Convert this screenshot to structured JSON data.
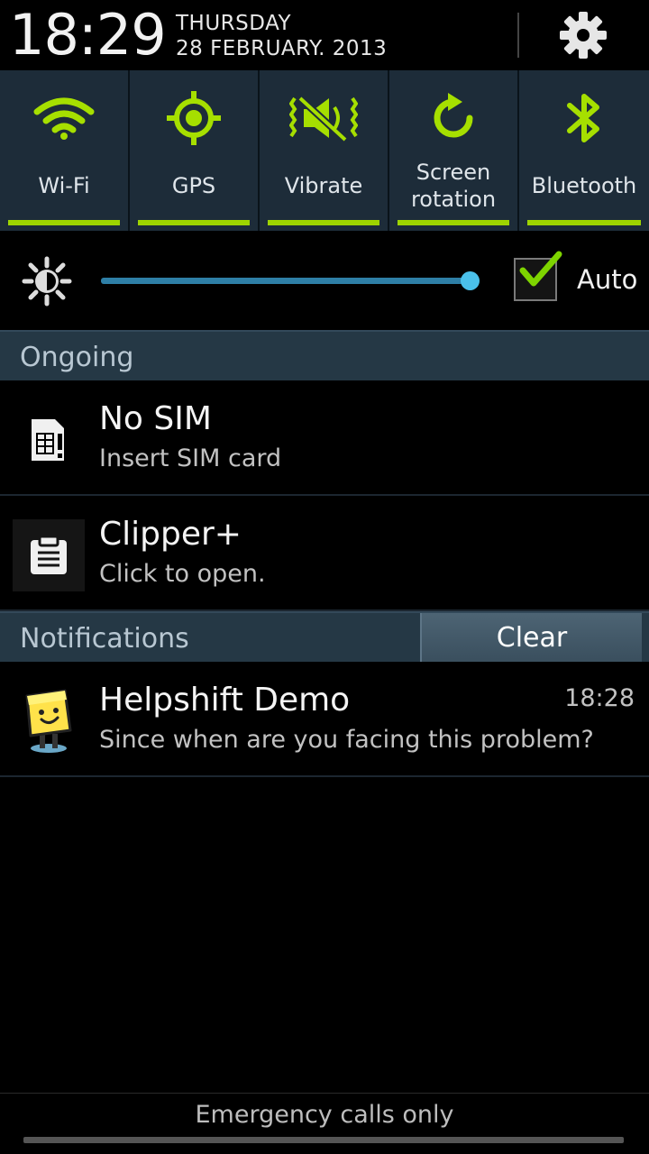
{
  "header": {
    "time": "18:29",
    "day": "THURSDAY",
    "date": "28 FEBRUARY. 2013",
    "settings_icon": "gear-icon"
  },
  "toggles": [
    {
      "label": "Wi-Fi",
      "icon": "wifi-icon",
      "active": true
    },
    {
      "label": "GPS",
      "icon": "gps-icon",
      "active": true
    },
    {
      "label": "Vibrate",
      "icon": "vibrate-icon",
      "active": true
    },
    {
      "label": "Screen rotation",
      "icon": "rotation-icon",
      "active": true
    },
    {
      "label": "Bluetooth",
      "icon": "bluetooth-icon",
      "active": true
    }
  ],
  "brightness": {
    "level": 1.0,
    "auto_label": "Auto",
    "auto_checked": true
  },
  "ongoing": {
    "title": "Ongoing",
    "items": [
      {
        "title": "No SIM",
        "subtitle": "Insert SIM card",
        "icon": "sim-card-icon"
      },
      {
        "title": "Clipper+",
        "subtitle": "Click to open.",
        "icon": "clipboard-icon"
      }
    ]
  },
  "notifications": {
    "title": "Notifications",
    "clear_label": "Clear",
    "items": [
      {
        "title": "Helpshift Demo",
        "subtitle": "Since when are you facing this problem?",
        "time": "18:28",
        "icon": "helpshift-mascot-icon"
      }
    ]
  },
  "footer": {
    "status": "Emergency calls only"
  },
  "colors": {
    "accent_green": "#9ed400",
    "slider_blue": "#2e7fa6",
    "panel_bg": "#1d2c39",
    "section_bg": "#253845"
  }
}
